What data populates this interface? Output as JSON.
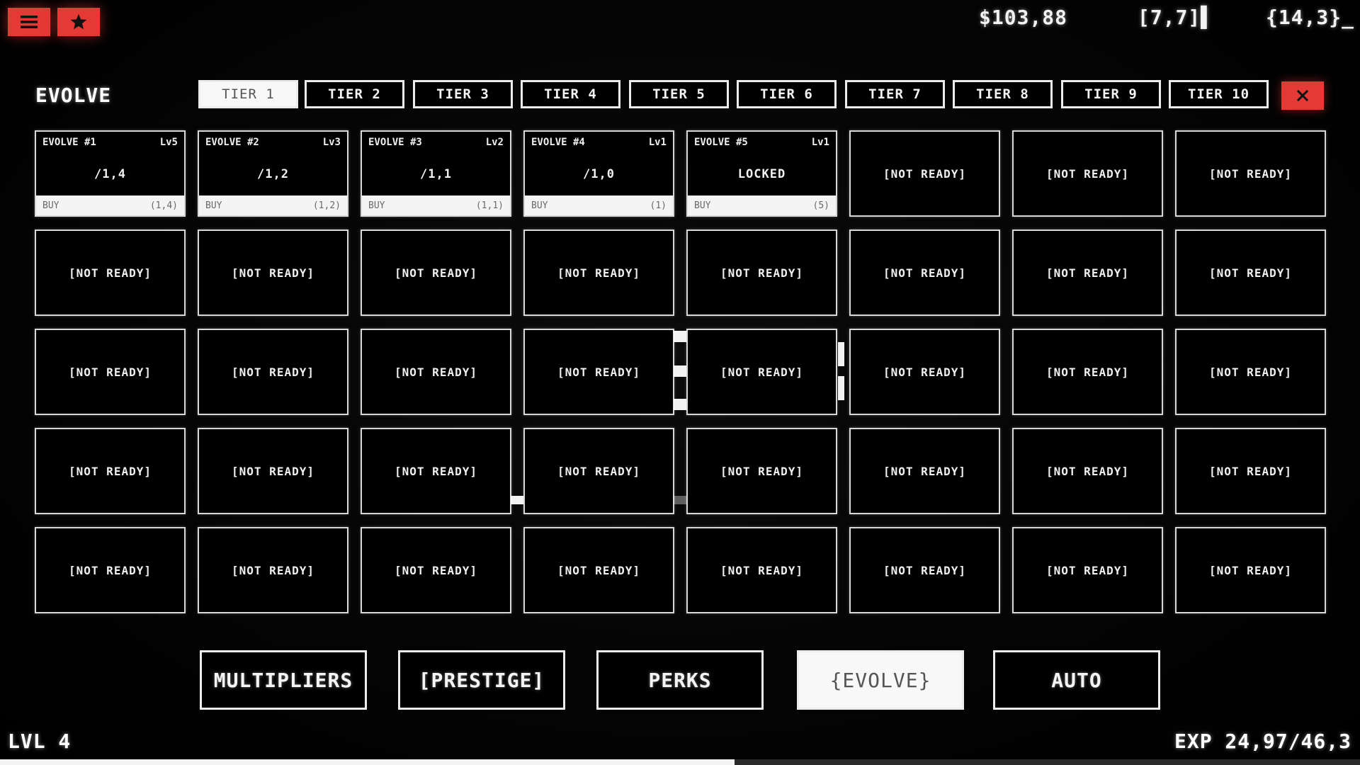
{
  "header": {
    "menu_icon": "hamburger-menu-icon",
    "star_icon": "star-icon",
    "money": "$103,88",
    "coord_a": "[7,7]▌",
    "coord_b": "{14,3}_"
  },
  "section": {
    "title": "EVOLVE",
    "close_icon": "close-x-icon"
  },
  "tabs": [
    {
      "label": "TIER 1",
      "active": true
    },
    {
      "label": "TIER 2",
      "active": false
    },
    {
      "label": "TIER 3",
      "active": false
    },
    {
      "label": "TIER 4",
      "active": false
    },
    {
      "label": "TIER 5",
      "active": false
    },
    {
      "label": "TIER 6",
      "active": false
    },
    {
      "label": "TIER 7",
      "active": false
    },
    {
      "label": "TIER 8",
      "active": false
    },
    {
      "label": "TIER 9",
      "active": false
    },
    {
      "label": "TIER 10",
      "active": false
    }
  ],
  "upgrades": [
    {
      "name": "EVOLVE #1",
      "level": "Lv5",
      "value": "/1,4",
      "buy": "BUY",
      "cost": "(1,4)"
    },
    {
      "name": "EVOLVE #2",
      "level": "Lv3",
      "value": "/1,2",
      "buy": "BUY",
      "cost": "(1,2)"
    },
    {
      "name": "EVOLVE #3",
      "level": "Lv2",
      "value": "/1,1",
      "buy": "BUY",
      "cost": "(1,1)"
    },
    {
      "name": "EVOLVE #4",
      "level": "Lv1",
      "value": "/1,0",
      "buy": "BUY",
      "cost": "(1)"
    },
    {
      "name": "EVOLVE #5",
      "level": "Lv1",
      "value": "LOCKED",
      "buy": "BUY",
      "cost": "(5)"
    }
  ],
  "not_ready_label": "[NOT READY]",
  "grid": {
    "columns": 8,
    "rows": 5
  },
  "nav": [
    {
      "label": "MULTIPLIERS",
      "active": false
    },
    {
      "label": "[PRESTIGE]",
      "active": false
    },
    {
      "label": "PERKS",
      "active": false
    },
    {
      "label": "{EVOLVE}",
      "active": true
    },
    {
      "label": "AUTO",
      "active": false
    }
  ],
  "footer": {
    "level": "LVL 4",
    "exp": "EXP 24,97/46,3",
    "exp_progress": 0.54
  },
  "colors": {
    "accent_red": "#e53935",
    "foreground": "#f4f4f4",
    "background": "#000000"
  }
}
